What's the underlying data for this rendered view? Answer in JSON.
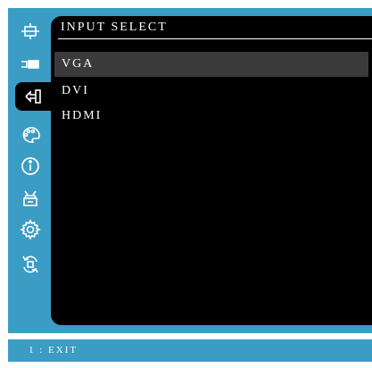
{
  "colors": {
    "accent": "#3b9cc4",
    "panel": "#000000",
    "selected_row": "#3a3a3a",
    "text": "#ffffff"
  },
  "sidebar": {
    "items": [
      {
        "icon": "display-adjust-icon"
      },
      {
        "icon": "input-projector-icon"
      },
      {
        "icon": "input-select-icon",
        "active": true
      },
      {
        "icon": "color-palette-icon"
      },
      {
        "icon": "information-icon"
      },
      {
        "icon": "manual-image-adjust-icon"
      },
      {
        "icon": "setup-gear-icon"
      },
      {
        "icon": "memory-recall-icon"
      }
    ]
  },
  "menu": {
    "title": "INPUT SELECT",
    "items": [
      {
        "label": "VGA",
        "selected": true
      },
      {
        "label": "DVI"
      },
      {
        "label": "HDMI"
      }
    ]
  },
  "footer": {
    "hint": "1 : EXIT"
  }
}
